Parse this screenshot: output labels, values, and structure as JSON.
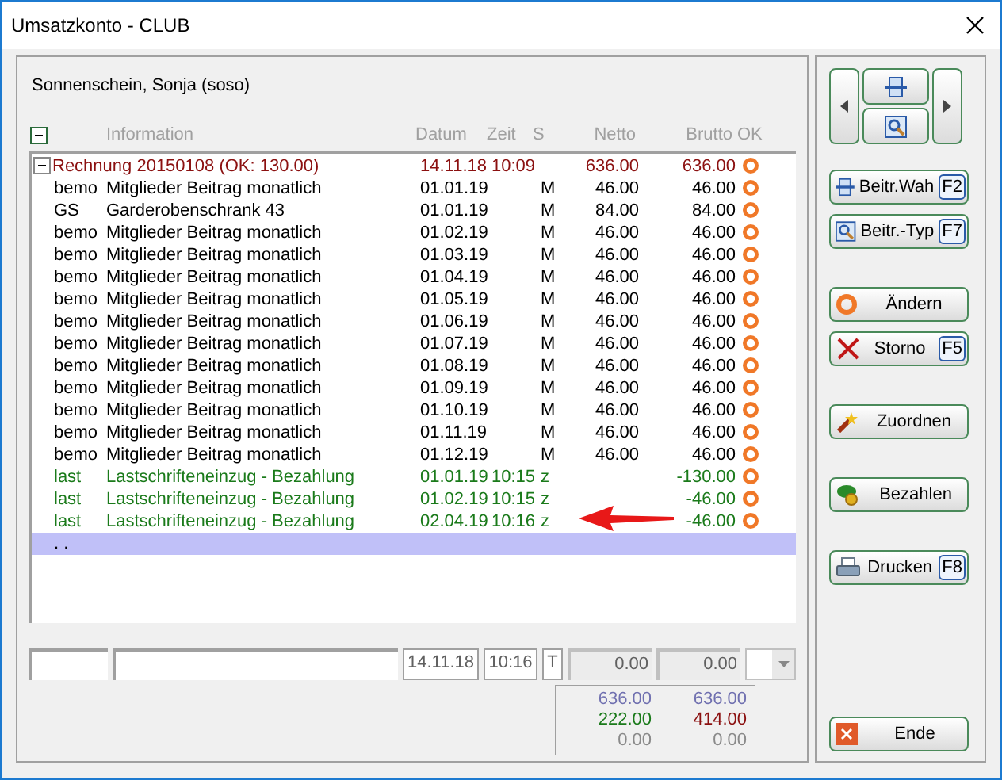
{
  "window": {
    "title": "Umsatzkonto - CLUB"
  },
  "customer": "Sonnenschein, Sonja (soso)",
  "table": {
    "expanded": true,
    "columns": [
      "Information",
      "Datum",
      "Zeit",
      "S",
      "Netto",
      "Brutto",
      "OK"
    ],
    "rows": [
      {
        "kind": "group",
        "expanded": true,
        "code": "",
        "info": "Rechnung 20150108 (OK: 130.00)",
        "date": "14.11.18",
        "time": "10:09",
        "s": "",
        "net": "636.00",
        "gross": "636.00",
        "ok": true,
        "selected": false
      },
      {
        "kind": "item",
        "code": "bemo",
        "info": "Mitglieder Beitrag monatlich",
        "date": "01.01.19",
        "time": "",
        "s": "M",
        "net": "46.00",
        "gross": "46.00",
        "ok": true,
        "selected": false
      },
      {
        "kind": "item",
        "code": "GS",
        "info": "Garderobenschrank 43",
        "date": "01.01.19",
        "time": "",
        "s": "M",
        "net": "84.00",
        "gross": "84.00",
        "ok": true,
        "selected": false
      },
      {
        "kind": "item",
        "code": "bemo",
        "info": "Mitglieder Beitrag monatlich",
        "date": "01.02.19",
        "time": "",
        "s": "M",
        "net": "46.00",
        "gross": "46.00",
        "ok": true,
        "selected": false
      },
      {
        "kind": "item",
        "code": "bemo",
        "info": "Mitglieder Beitrag monatlich",
        "date": "01.03.19",
        "time": "",
        "s": "M",
        "net": "46.00",
        "gross": "46.00",
        "ok": true,
        "selected": false
      },
      {
        "kind": "item",
        "code": "bemo",
        "info": "Mitglieder Beitrag monatlich",
        "date": "01.04.19",
        "time": "",
        "s": "M",
        "net": "46.00",
        "gross": "46.00",
        "ok": true,
        "selected": false
      },
      {
        "kind": "item",
        "code": "bemo",
        "info": "Mitglieder Beitrag monatlich",
        "date": "01.05.19",
        "time": "",
        "s": "M",
        "net": "46.00",
        "gross": "46.00",
        "ok": true,
        "selected": false
      },
      {
        "kind": "item",
        "code": "bemo",
        "info": "Mitglieder Beitrag monatlich",
        "date": "01.06.19",
        "time": "",
        "s": "M",
        "net": "46.00",
        "gross": "46.00",
        "ok": true,
        "selected": false
      },
      {
        "kind": "item",
        "code": "bemo",
        "info": "Mitglieder Beitrag monatlich",
        "date": "01.07.19",
        "time": "",
        "s": "M",
        "net": "46.00",
        "gross": "46.00",
        "ok": true,
        "selected": false
      },
      {
        "kind": "item",
        "code": "bemo",
        "info": "Mitglieder Beitrag monatlich",
        "date": "01.08.19",
        "time": "",
        "s": "M",
        "net": "46.00",
        "gross": "46.00",
        "ok": true,
        "selected": false
      },
      {
        "kind": "item",
        "code": "bemo",
        "info": "Mitglieder Beitrag monatlich",
        "date": "01.09.19",
        "time": "",
        "s": "M",
        "net": "46.00",
        "gross": "46.00",
        "ok": true,
        "selected": false
      },
      {
        "kind": "item",
        "code": "bemo",
        "info": "Mitglieder Beitrag monatlich",
        "date": "01.10.19",
        "time": "",
        "s": "M",
        "net": "46.00",
        "gross": "46.00",
        "ok": true,
        "selected": false
      },
      {
        "kind": "item",
        "code": "bemo",
        "info": "Mitglieder Beitrag monatlich",
        "date": "01.11.19",
        "time": "",
        "s": "M",
        "net": "46.00",
        "gross": "46.00",
        "ok": true,
        "selected": false
      },
      {
        "kind": "item",
        "code": "bemo",
        "info": "Mitglieder Beitrag monatlich",
        "date": "01.12.19",
        "time": "",
        "s": "M",
        "net": "46.00",
        "gross": "46.00",
        "ok": true,
        "selected": false
      },
      {
        "kind": "payment",
        "code": "last",
        "info": "Lastschrifteneinzug - Bezahlung",
        "date": "01.01.19",
        "time": "10:15",
        "s": "z",
        "net": "",
        "gross": "-130.00",
        "ok": true,
        "selected": false
      },
      {
        "kind": "payment",
        "code": "last",
        "info": "Lastschrifteneinzug - Bezahlung",
        "date": "01.02.19",
        "time": "10:15",
        "s": "z",
        "net": "",
        "gross": "-46.00",
        "ok": true,
        "selected": false
      },
      {
        "kind": "payment",
        "code": "last",
        "info": "Lastschrifteneinzug - Bezahlung",
        "date": "02.04.19",
        "time": "10:16",
        "s": "z",
        "net": "",
        "gross": "-46.00",
        "ok": true,
        "selected": false,
        "arrow": true
      },
      {
        "kind": "new",
        "code": ". .",
        "info": "",
        "date": "",
        "time": "",
        "s": "",
        "net": "",
        "gross": "",
        "ok": false,
        "selected": true
      }
    ]
  },
  "entry": {
    "date": "14.11.18",
    "time": "10:16",
    "type": "T",
    "net": "0.00",
    "gross": "0.00"
  },
  "totals": [
    {
      "net": "636.00",
      "gross": "636.00"
    },
    {
      "net": "222.00",
      "gross": "414.00"
    },
    {
      "net": "0.00",
      "gross": "0.00"
    }
  ],
  "buttons": [
    {
      "label": "Beitr.Wah",
      "key": "F2"
    },
    {
      "label": "Beitr.-Typ",
      "key": "F7"
    },
    {
      "label": "Ändern"
    },
    {
      "label": "Storno",
      "key": "F5"
    },
    {
      "label": "Zuordnen"
    },
    {
      "label": "Bezahlen"
    },
    {
      "label": "Drucken",
      "key": "F8"
    }
  ],
  "end_button": {
    "label": "Ende"
  }
}
